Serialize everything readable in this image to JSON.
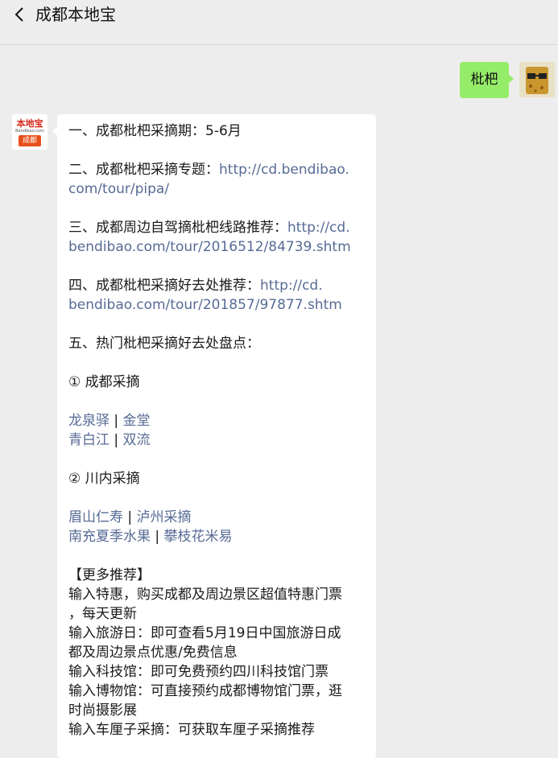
{
  "header": {
    "title": "成都本地宝"
  },
  "outgoing": {
    "text": "枇杷"
  },
  "bot": {
    "logo_text": "本地宝",
    "logo_sub": "Bendibao.com",
    "logo_city": "成都"
  },
  "message": {
    "l1": "一、成都枇杷采摘期：5-6月",
    "l2_label": "二、成都枇杷采摘专题：",
    "l2_link_a": "http://cd.bendibao.",
    "l2_link_b": "com/tour/pipa/",
    "l3_label": "三、成都周边自驾摘枇杷线路推荐：",
    "l3_link_a": "http://cd.",
    "l3_link_b": "bendibao.com/tour/2016512/84739.shtm",
    "l4_label": "四、成都枇杷采摘好去处推荐：",
    "l4_link_a": "http://cd.",
    "l4_link_b": "bendibao.com/tour/201857/97877.shtm",
    "l5": "五、热门枇杷采摘好去处盘点：",
    "sec1": "① 成都采摘",
    "s1_a": "龙泉驿",
    "s1_b": "金堂",
    "s1_c": "青白江",
    "s1_d": "双流",
    "sec2": "② 川内采摘",
    "s2_a": "眉山仁寿",
    "s2_b": "泸州采摘",
    "s2_c": "南充夏季水果",
    "s2_d": "攀枝花米易",
    "sep": " | ",
    "more": "【更多推荐】",
    "m1a": "输入特惠，购买成都及周边景区超值特惠门票",
    "m1b": "，每天更新",
    "m2a": "输入旅游日：即可查看5月19日中国旅游日成",
    "m2b": "都及周边景点优惠/免费信息",
    "m3": "输入科技馆：即可免费预约四川科技馆门票",
    "m4a": "输入博物馆：可直接预约成都博物馆门票，逛",
    "m4b": "时尚摄影展",
    "m5": "输入车厘子采摘：可获取车厘子采摘推荐"
  }
}
